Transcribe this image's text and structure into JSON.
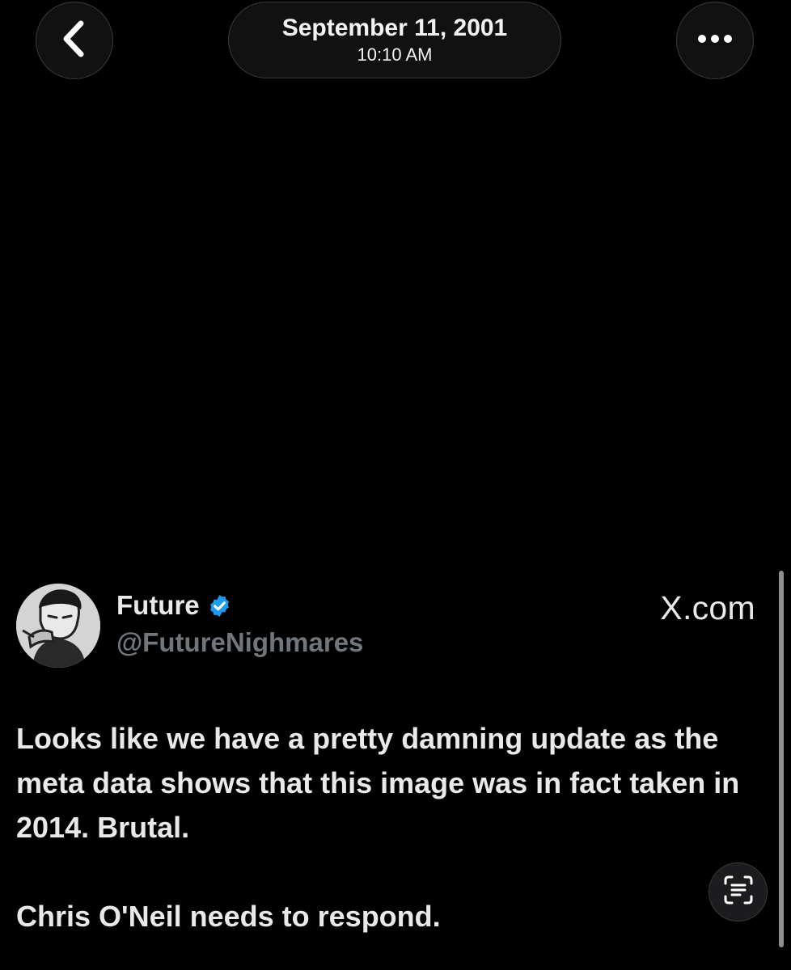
{
  "header": {
    "date": "September 11, 2001",
    "time": "10:10 AM",
    "back_icon": "chevron-left-icon",
    "more_icon": "ellipsis-icon"
  },
  "post": {
    "author_name": "Future",
    "handle": "@FutureNighmares",
    "source": "X.com",
    "verified_icon": "verified-badge-icon",
    "verified_color": "#1d9bf0",
    "paragraphs": [
      "Looks like we have a pretty damning update as the meta data shows that this image was in fact taken in 2014. Brutal.",
      "Chris O'Neil needs to respond."
    ]
  },
  "controls": {
    "live_text_icon": "live-text-scan-icon"
  },
  "colors": {
    "background": "#000000",
    "text": "#e7e9ea",
    "secondary_text": "#71767b"
  }
}
